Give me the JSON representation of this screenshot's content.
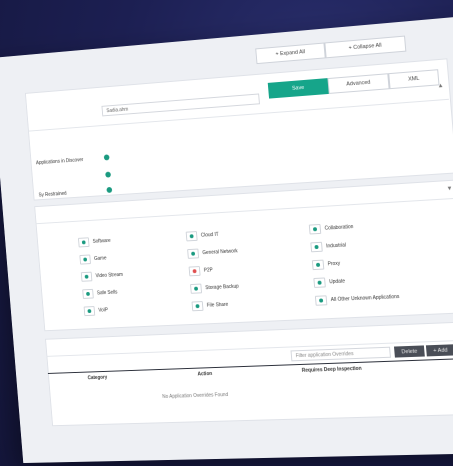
{
  "toolbar": {
    "expand_all": "+ Expand All",
    "collapse_all": "+ Collapse All"
  },
  "tabs": {
    "save": "Save",
    "advanced": "Advanced",
    "xml": "XML"
  },
  "form": {
    "name_value": "Sadia.ahm",
    "toggle_rows": [
      {
        "label": "Applications in Discover"
      },
      {
        "label": ""
      },
      {
        "label": "Sy Restrained"
      }
    ]
  },
  "apps": {
    "col1": [
      {
        "label": "Software"
      },
      {
        "label": "Game"
      },
      {
        "label": "Video Stream"
      },
      {
        "label": "Safe Sells"
      },
      {
        "label": "VoIP"
      }
    ],
    "col2": [
      {
        "label": "Cloud IT"
      },
      {
        "label": "General Network"
      },
      {
        "label": "P2P",
        "red": true
      },
      {
        "label": "Storage Backup"
      },
      {
        "label": "File Share"
      }
    ],
    "col3": [
      {
        "label": "Collaboration"
      },
      {
        "label": "Industrial"
      },
      {
        "label": "Proxy"
      },
      {
        "label": "Update"
      },
      {
        "label": "All Other Unknown Applications"
      }
    ]
  },
  "overrides": {
    "search_placeholder": "Filter application Overrides",
    "delete_label": "Delete",
    "add_label": "+ Add",
    "columns": [
      "Category",
      "Action",
      "Requires Deep Inspection"
    ],
    "empty_text": "No Application Overrides Found"
  },
  "colors": {
    "accent": "#16a58a",
    "background": "#1c1f52"
  }
}
